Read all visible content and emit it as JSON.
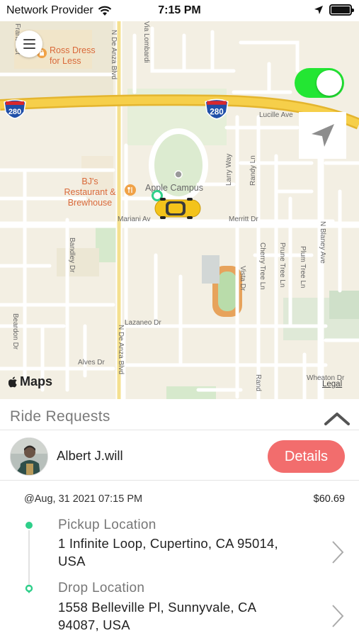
{
  "status_bar": {
    "carrier": "Network Provider",
    "time": "7:15 PM"
  },
  "map": {
    "poi_ross": "Ross Dress\nfor Less",
    "poi_bjs": "BJ's\nRestaurant &\nBrewhouse",
    "campus_label": "Apple Campus",
    "streets": {
      "de_anza_top": "N De Anza Blvd",
      "de_anza_bottom": "N De Anza Blvd",
      "lucille": "Lucille Ave",
      "merritt": "Merritt Dr",
      "mariani": "Mariani Av",
      "lazaneo": "Lazaneo Dr",
      "alves": "Alves Dr",
      "larry": "Larry Way",
      "randy": "Randy Ln",
      "randy_bottom": "Rand",
      "bandley": "Bandley Dr",
      "beardon": "Beardon Dr",
      "vista": "Vista Dr",
      "cherry": "Cherry Tree Ln",
      "prune": "Prune Tree Ln",
      "plum": "Plum Tree Ln",
      "blaney": "N Blaney Ave",
      "wheaton": "Wheaton Dr",
      "via_lombardi": "Via Lombardi",
      "franco": "Franco Ct",
      "interstate": "280"
    },
    "maps_brand": "Maps",
    "legal": "Legal"
  },
  "panel": {
    "title": "Ride Requests",
    "rider_name": "Albert J.will",
    "details_label": "Details",
    "date": "@Aug, 31 2021 07:15 PM",
    "fare": "$60.69",
    "pickup_label": "Pickup Location",
    "pickup_address": "1 Infinite Loop, Cupertino, CA 95014, USA",
    "drop_label": "Drop Location",
    "drop_address": "1558 Belleville Pl, Sunnyvale, CA 94087, USA"
  },
  "colors": {
    "toggle_on": "#23e633",
    "details_button": "#f26d6d",
    "pickup_dot": "#2ecf8a",
    "map_bg": "#f3efe3",
    "freeway": "#f5c842",
    "car": "#f3c31b"
  },
  "icons": {
    "menu": "hamburger-menu-icon",
    "locate": "location-arrow-icon",
    "collapse": "chevron-up-icon",
    "pickup": "pickup-dot-icon",
    "drop": "drop-pin-icon",
    "chevron": "chevron-right-icon",
    "car": "taxi-car-icon"
  }
}
